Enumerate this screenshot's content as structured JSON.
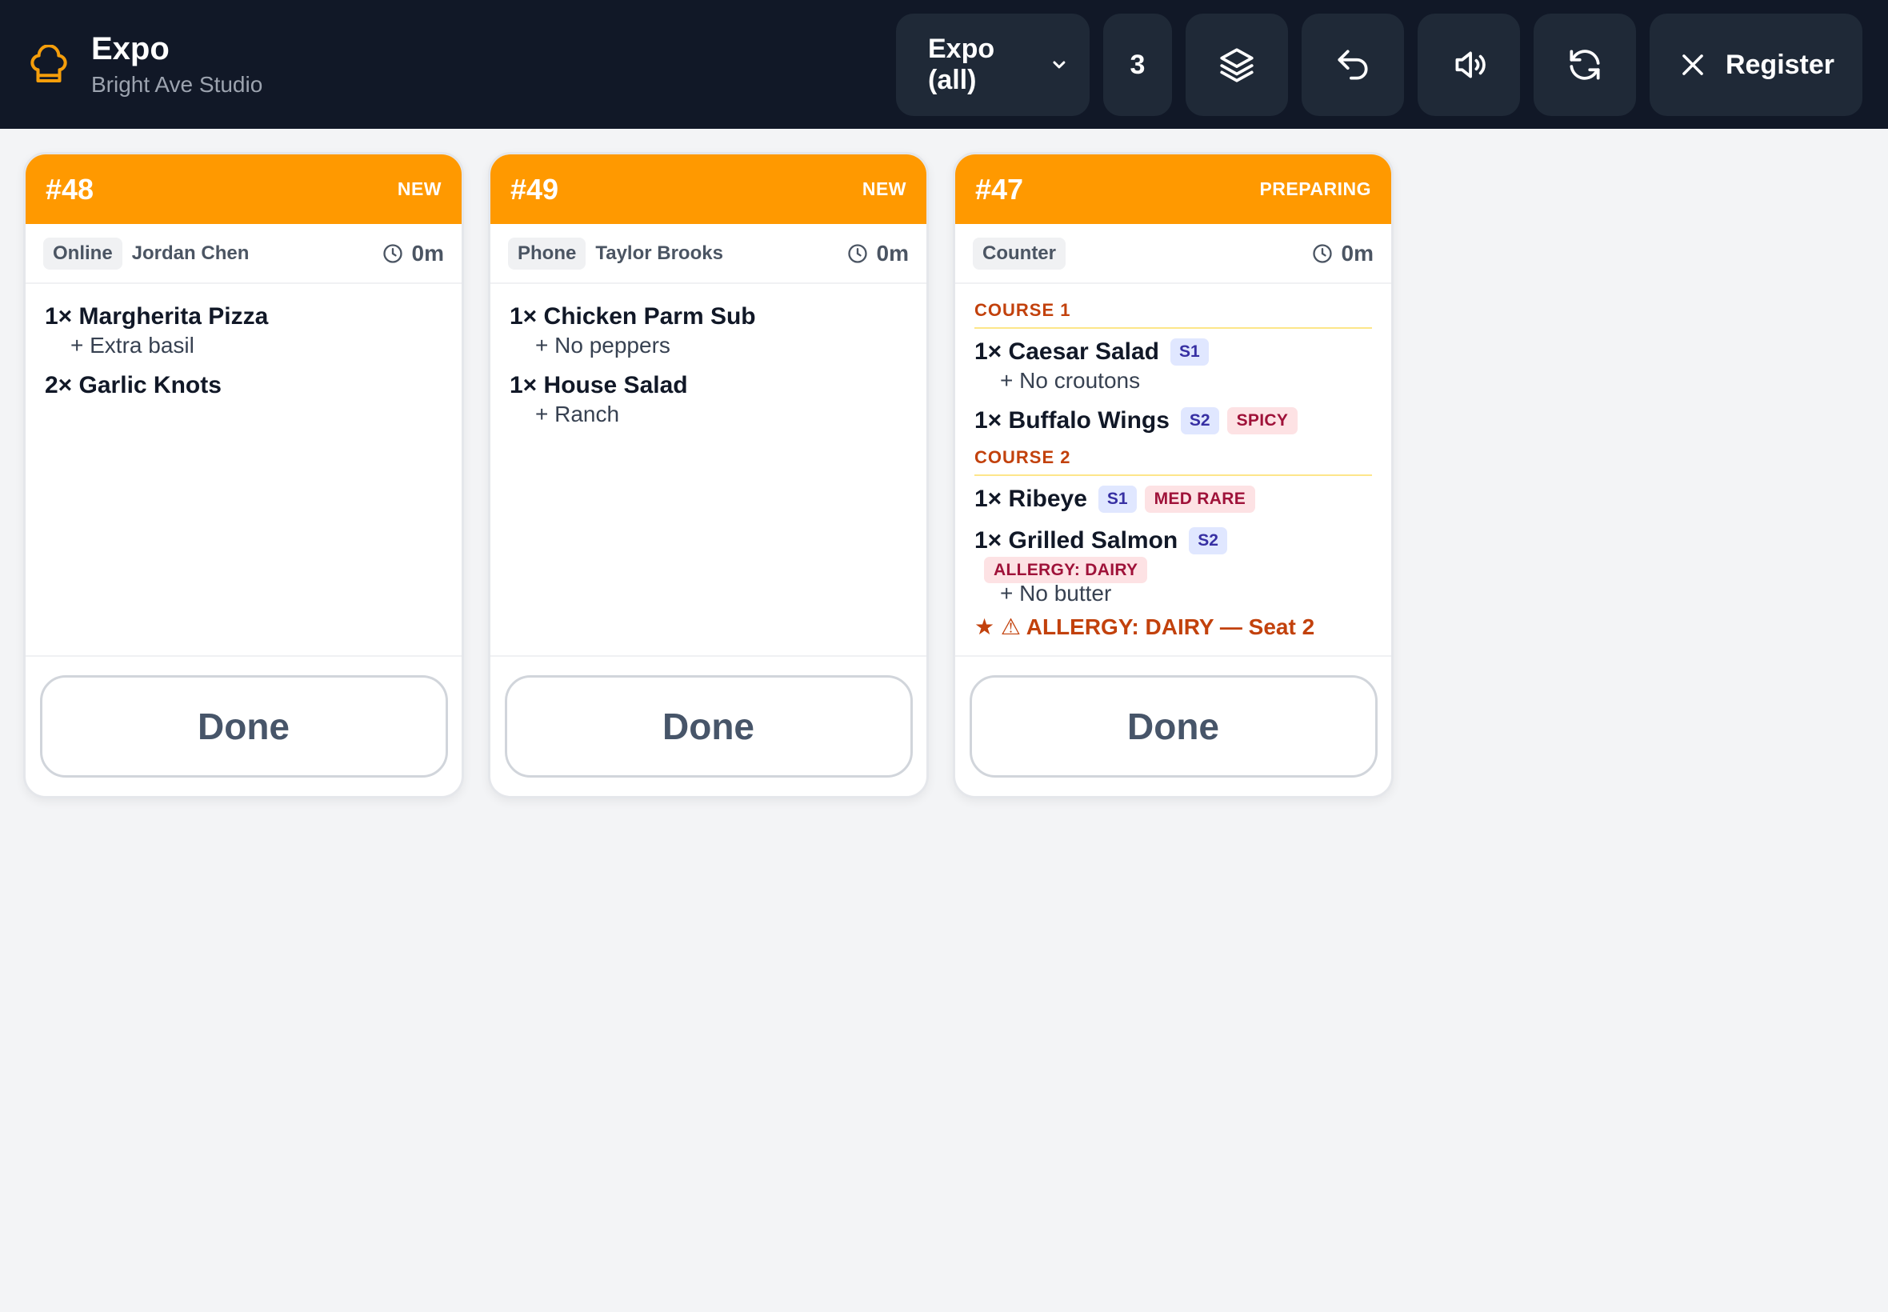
{
  "header": {
    "title": "Expo",
    "subtitle": "Bright Ave Studio",
    "station_select": "Expo (all)",
    "order_count": "3",
    "register_label": "Register",
    "icons": [
      "chef-hat-icon",
      "layers-icon",
      "undo-icon",
      "volume-icon",
      "refresh-icon",
      "close-icon"
    ]
  },
  "colors": {
    "header_bg": "#111827",
    "accent": "#ff9900",
    "course_header": "#c2410c",
    "seat_tag_bg": "#e0e7ff",
    "flag_tag_bg": "#fde2e4"
  },
  "orders": [
    {
      "number": "#48",
      "status": "NEW",
      "source": "Online",
      "customer": "Jordan Chen",
      "elapsed": "0m",
      "items": [
        {
          "name": "1× Margherita Pizza",
          "mods": [
            "+ Extra basil"
          ]
        },
        {
          "name": "2× Garlic Knots"
        }
      ],
      "done_label": "Done"
    },
    {
      "number": "#49",
      "status": "NEW",
      "source": "Phone",
      "customer": "Taylor Brooks",
      "elapsed": "0m",
      "items": [
        {
          "name": "1× Chicken Parm Sub",
          "mods": [
            "+ No peppers"
          ]
        },
        {
          "name": "1× House Salad",
          "mods": [
            "+ Ranch"
          ]
        }
      ],
      "done_label": "Done"
    },
    {
      "number": "#47",
      "status": "PREPARING",
      "source": "Counter",
      "elapsed": "0m",
      "courses": [
        {
          "label": "COURSE 1",
          "items": [
            {
              "name": "1× Caesar Salad",
              "seat": "S1",
              "mods": [
                "+ No croutons"
              ]
            },
            {
              "name": "1× Buffalo Wings",
              "seat": "S2",
              "flag": "SPICY"
            }
          ]
        },
        {
          "label": "COURSE 2",
          "items": [
            {
              "name": "1× Ribeye",
              "seat": "S1",
              "flag": "MED RARE"
            },
            {
              "name": "1× Grilled Salmon",
              "seat": "S2",
              "flag_below": "ALLERGY: DAIRY",
              "mods": [
                "+ No butter"
              ]
            }
          ]
        }
      ],
      "allergy_note": "★ ⚠ ALLERGY: DAIRY — Seat 2",
      "done_label": "Done"
    }
  ]
}
